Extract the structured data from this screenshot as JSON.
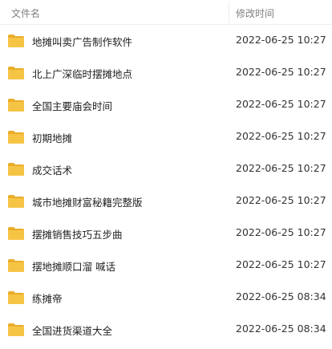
{
  "header": {
    "name_label": "文件名",
    "date_label": "修改时间"
  },
  "files": [
    {
      "name": "地摊叫卖广告制作软件",
      "modified": "2022-06-25 10:27",
      "icon": "folder-icon"
    },
    {
      "name": "北上广深临时摆摊地点",
      "modified": "2022-06-25 10:27",
      "icon": "folder-icon"
    },
    {
      "name": "全国主要庙会时间",
      "modified": "2022-06-25 10:27",
      "icon": "folder-icon"
    },
    {
      "name": "初期地摊",
      "modified": "2022-06-25 10:27",
      "icon": "folder-icon"
    },
    {
      "name": "成交话术",
      "modified": "2022-06-25 10:27",
      "icon": "folder-icon"
    },
    {
      "name": "城市地摊财富秘籍完整版",
      "modified": "2022-06-25 10:27",
      "icon": "folder-icon"
    },
    {
      "name": "摆摊销售技巧五步曲",
      "modified": "2022-06-25 10:27",
      "icon": "folder-icon"
    },
    {
      "name": "摆地摊顺口溜 喊话",
      "modified": "2022-06-25 10:27",
      "icon": "folder-icon"
    },
    {
      "name": "练摊帝",
      "modified": "2022-06-25 08:34",
      "icon": "folder-icon"
    },
    {
      "name": "全国进货渠道大全",
      "modified": "2022-06-25 08:34",
      "icon": "folder-icon"
    }
  ],
  "colors": {
    "folder": "#f6c445",
    "folder_back": "#e9ad2a",
    "header_text": "#808080"
  }
}
